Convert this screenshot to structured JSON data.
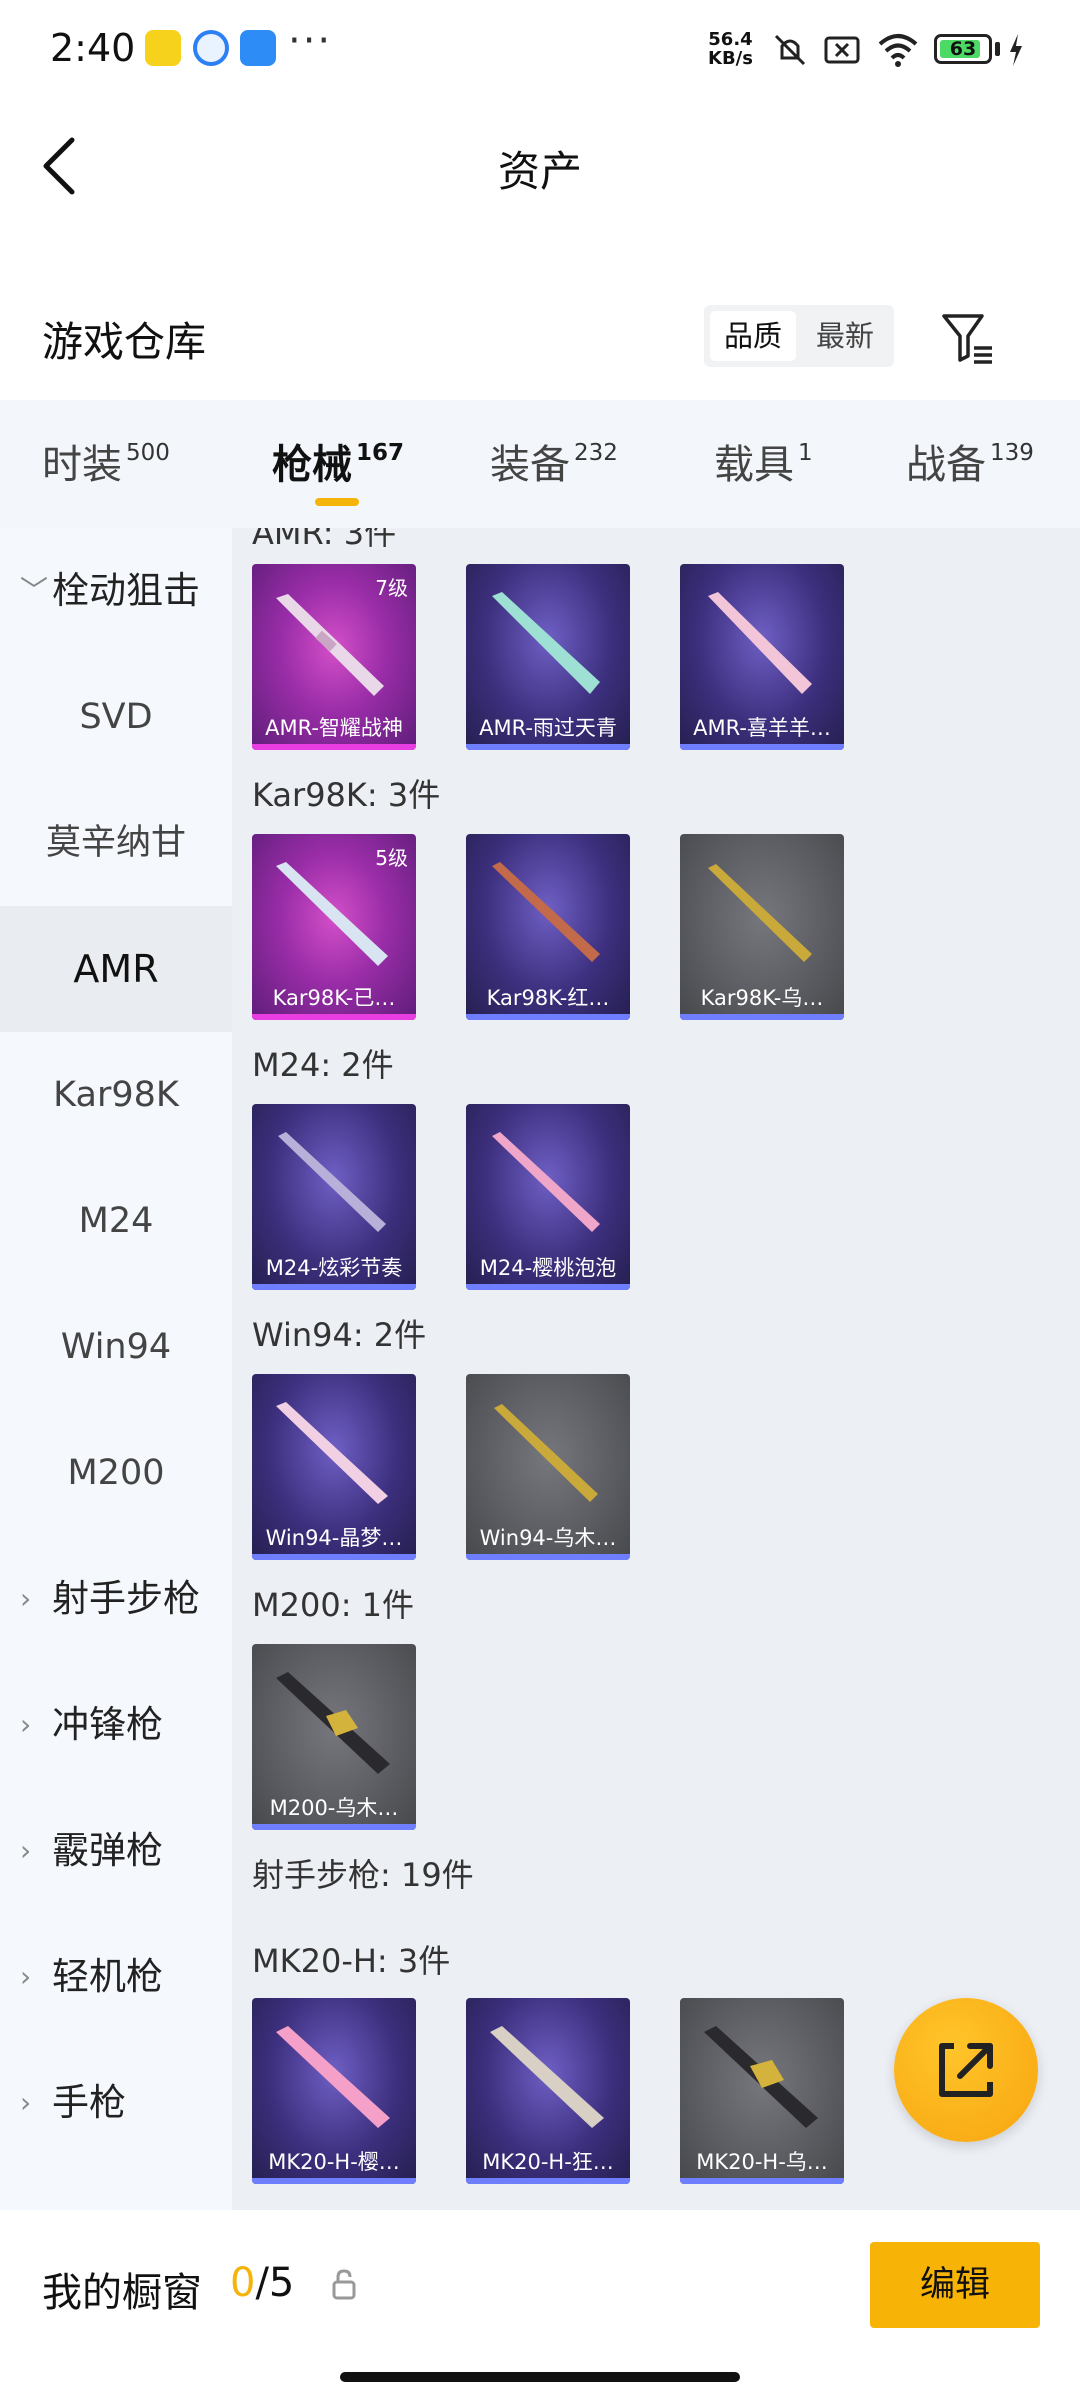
{
  "status_bar": {
    "time": "2:40",
    "net_speed_value": "56.4",
    "net_speed_unit": "KB/s",
    "battery": "63"
  },
  "header": {
    "title": "资产"
  },
  "warehouse": {
    "title": "游戏仓库",
    "sort_options": [
      "品质",
      "最新"
    ],
    "active_sort": "品质"
  },
  "tabs": [
    {
      "label": "时装",
      "count": "500"
    },
    {
      "label": "枪械",
      "count": "167"
    },
    {
      "label": "装备",
      "count": "232"
    },
    {
      "label": "载具",
      "count": "1"
    },
    {
      "label": "战备",
      "count": "139"
    }
  ],
  "active_tab": "枪械",
  "sidebar": {
    "items": [
      {
        "label": "栓动狙击",
        "type": "group",
        "expanded": true
      },
      {
        "label": "SVD",
        "type": "sub"
      },
      {
        "label": "莫辛纳甘",
        "type": "sub"
      },
      {
        "label": "AMR",
        "type": "sub",
        "active": true
      },
      {
        "label": "Kar98K",
        "type": "sub"
      },
      {
        "label": "M24",
        "type": "sub"
      },
      {
        "label": "Win94",
        "type": "sub"
      },
      {
        "label": "M200",
        "type": "sub"
      },
      {
        "label": "射手步枪",
        "type": "group"
      },
      {
        "label": "冲锋枪",
        "type": "group"
      },
      {
        "label": "霰弹枪",
        "type": "group"
      },
      {
        "label": "轻机枪",
        "type": "group"
      },
      {
        "label": "手枪",
        "type": "group"
      }
    ]
  },
  "content": {
    "groups": [
      {
        "label": "AMR: 3件",
        "items": [
          {
            "name": "AMR-智耀战神",
            "level": "7级",
            "rarity": "legend"
          },
          {
            "name": "AMR-雨过天青",
            "rarity": "epic"
          },
          {
            "name": "AMR-喜羊羊…",
            "rarity": "epic"
          }
        ]
      },
      {
        "label": "Kar98K: 3件",
        "items": [
          {
            "name": "Kar98K-已…",
            "level": "5级",
            "rarity": "legend"
          },
          {
            "name": "Kar98K-红…",
            "rarity": "epic"
          },
          {
            "name": "Kar98K-乌…",
            "rarity": "plain"
          }
        ]
      },
      {
        "label": "M24: 2件",
        "items": [
          {
            "name": "M24-炫彩节奏",
            "rarity": "epic"
          },
          {
            "name": "M24-樱桃泡泡",
            "rarity": "epic"
          }
        ]
      },
      {
        "label": "Win94: 2件",
        "items": [
          {
            "name": "Win94-晶梦…",
            "rarity": "epic"
          },
          {
            "name": "Win94-乌木…",
            "rarity": "plain"
          }
        ]
      },
      {
        "label": "M200: 1件",
        "items": [
          {
            "name": "M200-乌木…",
            "rarity": "plain"
          }
        ]
      },
      {
        "label": "射手步枪: 19件",
        "items": []
      },
      {
        "label": "MK20-H: 3件",
        "items": [
          {
            "name": "MK20-H-樱…",
            "rarity": "epic"
          },
          {
            "name": "MK20-H-狂…",
            "rarity": "epic"
          },
          {
            "name": "MK20-H-乌…",
            "rarity": "plain"
          }
        ]
      }
    ]
  },
  "bottom_bar": {
    "label": "我的橱窗",
    "count_current": "0",
    "count_total": "/5",
    "edit_label": "编辑"
  },
  "colors": {
    "accent": "#f7b407",
    "legend": "#9a2da8",
    "epic": "#3c2f7d",
    "plain": "#5a5b60"
  }
}
